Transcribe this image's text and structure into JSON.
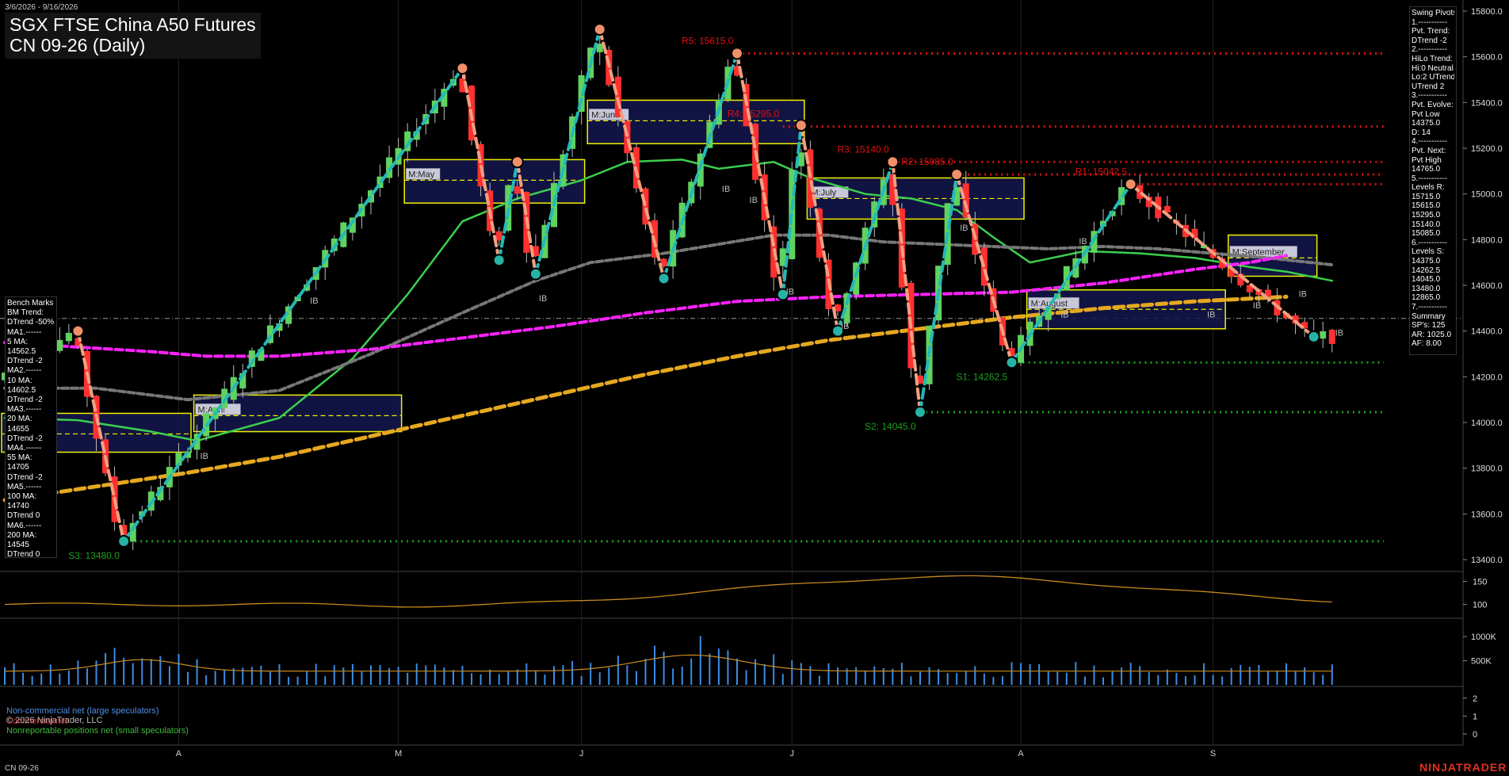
{
  "header": {
    "date_range": "3/6/2026 - 9/16/2026",
    "title": "SGX FTSE China A50 Futures",
    "subtitle": "CN 09-26 (Daily)"
  },
  "colors": {
    "background": "#000000",
    "up_bar": "#5fd35f",
    "down_bar": "#ff3030",
    "ma20": "#3ccf4e",
    "ma55": "#777777",
    "ma100": "#ff22ff",
    "ma200": "#e6a820",
    "swing_up": "#25b8b8",
    "swing_down": "#f0a080",
    "resistance": "#e01010",
    "support": "#1aa01a",
    "box_border": "#f0f000",
    "box_fill": "#14184e"
  },
  "bench_marks": {
    "title": "Bench Marks",
    "lines": [
      "BM Trend:",
      "DTrend -50%",
      "MA1.------",
      "5 MA:",
      "14562.5",
      "DTrend -2",
      "MA2.------",
      "10 MA:",
      "14602.5",
      "DTrend -2",
      "MA3.------",
      "20 MA:",
      "14655",
      "DTrend -2",
      "MA4.------",
      "55 MA:",
      "14705",
      "DTrend -2",
      "MA5.------",
      "100 MA:",
      "14740",
      "DTrend 0",
      "MA6.------",
      "200 MA:",
      "14545",
      "DTrend 0"
    ]
  },
  "swing_pivots": {
    "title": "Swing Pivots",
    "lines": [
      "1.-----------",
      "Pvt. Trend:",
      "DTrend -2",
      "2.-----------",
      "HiLo Trend:",
      "Hi:0 Neutral",
      "Lo:2 UTrend",
      "UTrend 2",
      "3.-----------",
      "Pvt. Evolve:",
      "Pvt Low",
      "14375.0",
      "D: 14",
      "4.-----------",
      "Pvt. Next:",
      "Pvt High",
      "14765.0",
      "5.-----------",
      "Levels R:",
      "15715.0",
      "15615.0",
      "15295.0",
      "15140.0",
      "15085.0",
      "6.-----------",
      "Levels S:",
      "14375.0",
      "14262.5",
      "14045.0",
      "13480.0",
      "12865.0",
      "7.-----------",
      "Summary",
      "SP's: 125",
      "AR: 1025.0",
      "AF: 8.00"
    ]
  },
  "levels": {
    "resistance": [
      {
        "label": "R5: 15615.0",
        "value": 15615.0,
        "from_index": 80
      },
      {
        "label": "R4: 15295.0",
        "value": 15295.0,
        "from_index": 85
      },
      {
        "label": "R3: 15140.0",
        "value": 15140.0,
        "from_index": 97
      },
      {
        "label": "R2: 15085.0",
        "value": 15085.0,
        "from_index": 104
      },
      {
        "label": "R1: 15042.5",
        "value": 15042.5,
        "from_index": 123
      }
    ],
    "support": [
      {
        "label": "S1: 14262.5",
        "value": 14262.5,
        "from_index": 110
      },
      {
        "label": "S2: 14045.0",
        "value": 14045.0,
        "from_index": 100
      },
      {
        "label": "S3: 13480.0",
        "value": 13480.0,
        "from_index": 13
      }
    ]
  },
  "month_boxes": [
    {
      "label": "M:April",
      "start_index": 21,
      "end_index": 43,
      "high": 14120,
      "low": 13960,
      "mid": 14030
    },
    {
      "label": "M:May",
      "start_index": 44,
      "end_index": 63,
      "high": 15150,
      "low": 14960,
      "mid": 15060
    },
    {
      "label": "M:June",
      "start_index": 64,
      "end_index": 87,
      "high": 15410,
      "low": 15220,
      "mid": 15320
    },
    {
      "label": "M:July",
      "start_index": 88,
      "end_index": 111,
      "high": 15070,
      "low": 14890,
      "mid": 14980
    },
    {
      "label": "M:August",
      "start_index": 112,
      "end_index": 133,
      "high": 14580,
      "low": 14410,
      "mid": 14495
    },
    {
      "label": "M:September",
      "start_index": 134,
      "end_index": 143,
      "high": 14820,
      "low": 14640,
      "mid": 14720
    },
    {
      "label": "",
      "start_index": 0,
      "end_index": 20,
      "high": 14040,
      "low": 13870,
      "mid": 13950
    }
  ],
  "ib_markers": [
    {
      "label": "IB",
      "index": 21,
      "value": 13840
    },
    {
      "label": "IB",
      "index": 33,
      "value": 14520
    },
    {
      "label": "IB",
      "index": 58,
      "value": 14530
    },
    {
      "label": "IB",
      "index": 78,
      "value": 15010
    },
    {
      "label": "IB",
      "index": 81,
      "value": 14960
    },
    {
      "label": "IB",
      "index": 85,
      "value": 14560
    },
    {
      "label": "IB",
      "index": 91,
      "value": 14410
    },
    {
      "label": "IB",
      "index": 104,
      "value": 14840
    },
    {
      "label": "IB",
      "index": 115,
      "value": 14460
    },
    {
      "label": "IB",
      "index": 117,
      "value": 14780
    },
    {
      "label": "IB",
      "index": 131,
      "value": 14460
    },
    {
      "label": "IB",
      "index": 136,
      "value": 14500
    },
    {
      "label": "IB",
      "index": 141,
      "value": 14550
    },
    {
      "label": "IB",
      "index": 145,
      "value": 14380
    }
  ],
  "right_axis": {
    "price_ticks": [
      "15800.0",
      "15600.0",
      "15400.0",
      "15200.0",
      "15000.0",
      "14800.0",
      "14600.0",
      "14400.0",
      "14200.0",
      "14000.0",
      "13800.0",
      "13600.0",
      "13400.0"
    ],
    "indicator_ticks": [
      "150",
      "100"
    ],
    "volume_ticks": [
      "1000K",
      "500K"
    ],
    "cot_ticks": [
      "2",
      "1",
      "0"
    ]
  },
  "x_axis": {
    "labels": [
      {
        "label": "A",
        "index": 19
      },
      {
        "label": "M",
        "index": 43
      },
      {
        "label": "J",
        "index": 63
      },
      {
        "label": "J",
        "index": 86
      },
      {
        "label": "A",
        "index": 111
      },
      {
        "label": "S",
        "index": 132
      }
    ]
  },
  "cot_legend": {
    "non_commercial": "Non-commercial net (large speculators)",
    "commercial": "Commercial net",
    "copyright": "© 2026 NinjaTrader, LLC",
    "nonreportable": "Nonreportable positions net (small speculators)"
  },
  "footer": {
    "instrument": "CN 09-26",
    "brand": "NINJATRADER"
  },
  "chart_data": {
    "type": "candlestick",
    "title": "SGX FTSE China A50 Futures",
    "subtitle": "CN 09-26 (Daily)",
    "price_range": [
      13350,
      15850
    ],
    "bar_count": 146,
    "swing_pivots": [
      {
        "index": 8,
        "value": 14400,
        "kind": "high"
      },
      {
        "index": 13,
        "value": 13480,
        "kind": "low"
      },
      {
        "index": 50,
        "value": 15550,
        "kind": "high"
      },
      {
        "index": 54,
        "value": 14710,
        "kind": "low"
      },
      {
        "index": 56,
        "value": 15140,
        "kind": "high"
      },
      {
        "index": 58,
        "value": 14650,
        "kind": "low"
      },
      {
        "index": 65,
        "value": 15720,
        "kind": "high"
      },
      {
        "index": 72,
        "value": 14630,
        "kind": "low"
      },
      {
        "index": 80,
        "value": 15615,
        "kind": "high"
      },
      {
        "index": 85,
        "value": 14560,
        "kind": "low"
      },
      {
        "index": 87,
        "value": 15300,
        "kind": "high"
      },
      {
        "index": 91,
        "value": 14400,
        "kind": "low"
      },
      {
        "index": 97,
        "value": 15140,
        "kind": "high"
      },
      {
        "index": 100,
        "value": 14045,
        "kind": "low"
      },
      {
        "index": 104,
        "value": 15085,
        "kind": "high"
      },
      {
        "index": 110,
        "value": 14262.5,
        "kind": "low"
      },
      {
        "index": 123,
        "value": 15042.5,
        "kind": "high"
      },
      {
        "index": 143,
        "value": 14375,
        "kind": "low"
      }
    ],
    "moving_averages": [
      {
        "name": "20 MA",
        "points": [
          [
            0,
            14020
          ],
          [
            8,
            14010
          ],
          [
            16,
            13960
          ],
          [
            21,
            13920
          ],
          [
            30,
            14020
          ],
          [
            38,
            14280
          ],
          [
            44,
            14560
          ],
          [
            50,
            14880
          ],
          [
            56,
            14980
          ],
          [
            63,
            15060
          ],
          [
            68,
            15140
          ],
          [
            74,
            15150
          ],
          [
            78,
            15110
          ],
          [
            84,
            15140
          ],
          [
            88,
            15070
          ],
          [
            94,
            15000
          ],
          [
            99,
            14980
          ],
          [
            104,
            14930
          ],
          [
            108,
            14810
          ],
          [
            112,
            14700
          ],
          [
            118,
            14750
          ],
          [
            124,
            14740
          ],
          [
            130,
            14720
          ],
          [
            136,
            14680
          ],
          [
            140,
            14660
          ],
          [
            145,
            14620
          ]
        ]
      },
      {
        "name": "55 MA",
        "points": [
          [
            0,
            14150
          ],
          [
            10,
            14150
          ],
          [
            20,
            14100
          ],
          [
            30,
            14140
          ],
          [
            40,
            14300
          ],
          [
            50,
            14480
          ],
          [
            58,
            14620
          ],
          [
            64,
            14700
          ],
          [
            72,
            14740
          ],
          [
            78,
            14780
          ],
          [
            84,
            14820
          ],
          [
            90,
            14820
          ],
          [
            96,
            14790
          ],
          [
            102,
            14780
          ],
          [
            108,
            14770
          ],
          [
            114,
            14760
          ],
          [
            120,
            14770
          ],
          [
            126,
            14760
          ],
          [
            132,
            14740
          ],
          [
            138,
            14720
          ],
          [
            145,
            14690
          ]
        ]
      },
      {
        "name": "100 MA",
        "points": [
          [
            0,
            14350
          ],
          [
            8,
            14330
          ],
          [
            16,
            14310
          ],
          [
            22,
            14290
          ],
          [
            30,
            14290
          ],
          [
            40,
            14320
          ],
          [
            50,
            14370
          ],
          [
            60,
            14420
          ],
          [
            70,
            14480
          ],
          [
            80,
            14530
          ],
          [
            90,
            14550
          ],
          [
            100,
            14560
          ],
          [
            110,
            14570
          ],
          [
            120,
            14610
          ],
          [
            130,
            14670
          ],
          [
            136,
            14700
          ],
          [
            140,
            14730
          ]
        ]
      },
      {
        "name": "200 MA",
        "points": [
          [
            0,
            13660
          ],
          [
            10,
            13720
          ],
          [
            20,
            13780
          ],
          [
            30,
            13850
          ],
          [
            40,
            13940
          ],
          [
            50,
            14030
          ],
          [
            60,
            14120
          ],
          [
            70,
            14210
          ],
          [
            80,
            14290
          ],
          [
            90,
            14360
          ],
          [
            100,
            14410
          ],
          [
            110,
            14460
          ],
          [
            120,
            14500
          ],
          [
            130,
            14530
          ],
          [
            140,
            14550
          ]
        ]
      }
    ]
  }
}
